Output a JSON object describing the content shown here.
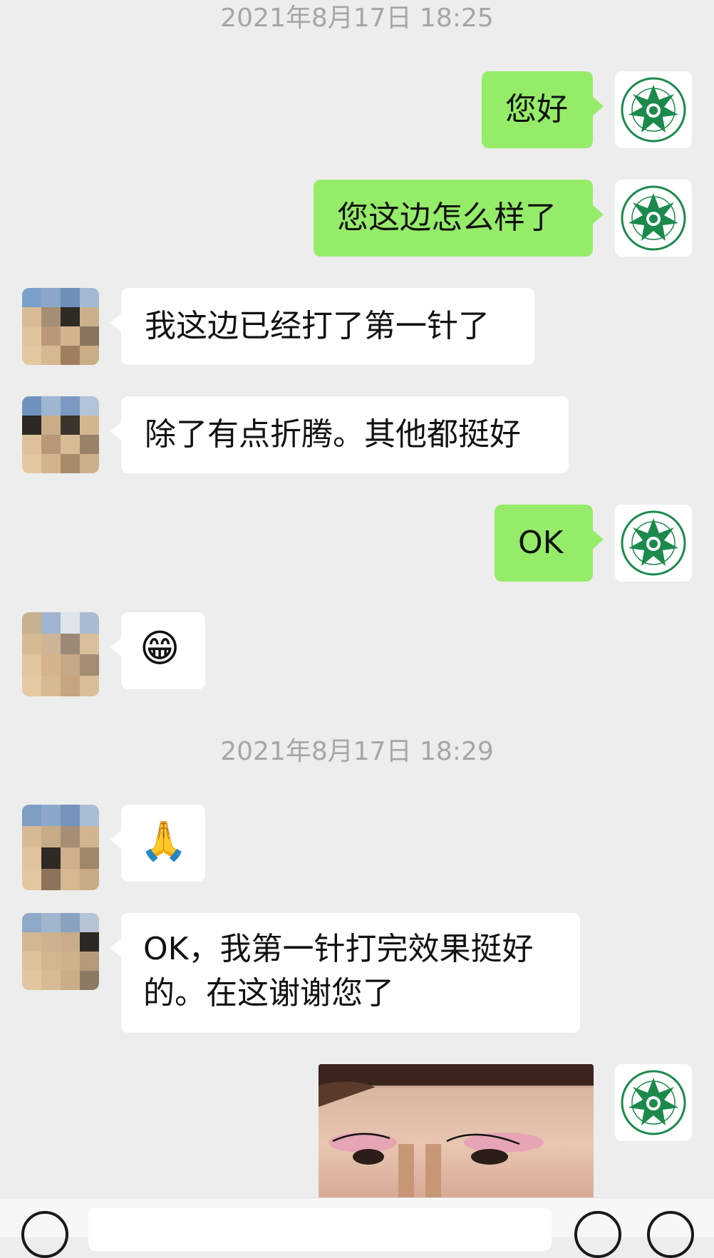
{
  "chat": {
    "timestamps": [
      "2021年8月17日 18:25",
      "2021年8月17日 18:29"
    ],
    "messages": [
      {
        "from": "self",
        "type": "text",
        "text": "您好"
      },
      {
        "from": "self",
        "type": "text",
        "text": "您这边怎么样了"
      },
      {
        "from": "other",
        "type": "text",
        "text": "我这边已经打了第一针了"
      },
      {
        "from": "other",
        "type": "text",
        "text": "除了有点折腾。其他都挺好"
      },
      {
        "from": "self",
        "type": "text",
        "text": "OK"
      },
      {
        "from": "other",
        "type": "emoji",
        "text": "😁"
      },
      {
        "from": "other",
        "type": "emoji",
        "text": "🙏"
      },
      {
        "from": "other",
        "type": "text",
        "text": "OK，我第一针打完效果挺好的。在这谢谢您了"
      },
      {
        "from": "self",
        "type": "image",
        "icon": "eye-makeup-photo"
      }
    ]
  },
  "colors": {
    "background": "#ededed",
    "outgoing_bubble": "#95ec69",
    "incoming_bubble": "#ffffff",
    "timestamp_text": "#a6a6a6",
    "logo_green": "#1b8a4c"
  },
  "avatars": {
    "self_icon": "green-star-seal-logo",
    "other_icon": "pixelated-avatar"
  },
  "input_bar": {
    "left_icon": "voice-icon",
    "right_icons": [
      "emoji-icon",
      "add-icon"
    ]
  }
}
